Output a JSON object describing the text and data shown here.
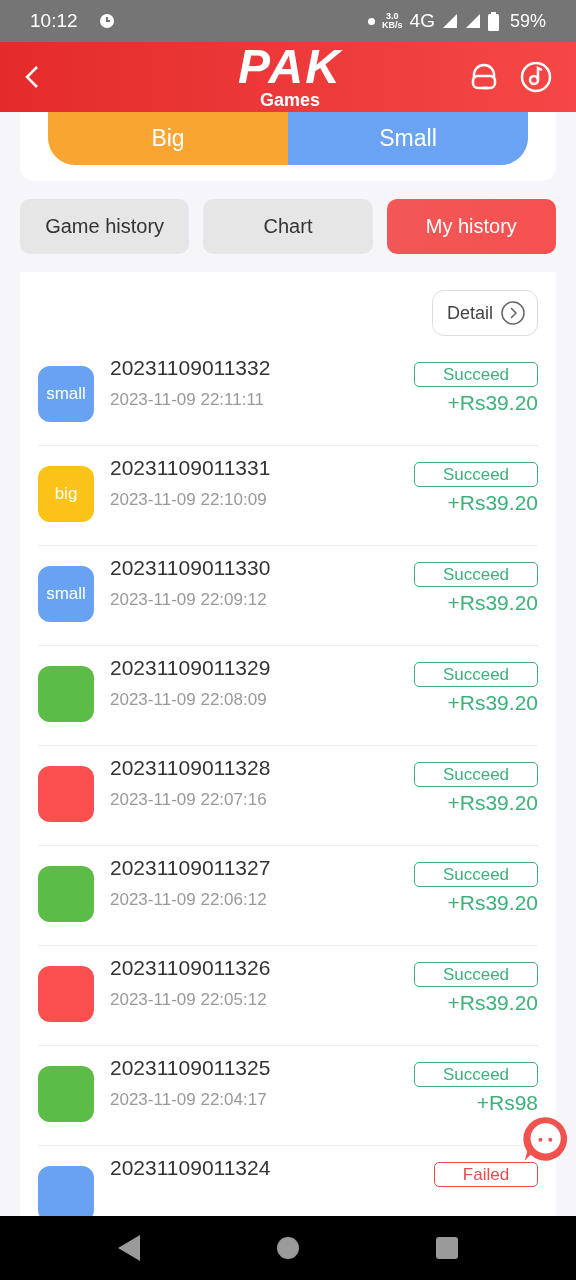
{
  "status_bar": {
    "time": "10:12",
    "speed_value": "3.0",
    "speed_unit": "KB/s",
    "network": "4G",
    "battery": "59%"
  },
  "header": {
    "logo_main": "PAK",
    "logo_sub": "Games"
  },
  "bet_buttons": [
    {
      "label": "Big",
      "kind": "big"
    },
    {
      "label": "Small",
      "kind": "small"
    }
  ],
  "tabs": [
    {
      "label": "Game history",
      "selected": false
    },
    {
      "label": "Chart",
      "selected": false
    },
    {
      "label": "My history",
      "selected": true
    }
  ],
  "detail_button": "Detail",
  "records": [
    {
      "period": "20231109011332",
      "time": "2023-11-09 22:11:11",
      "result": "small",
      "color": "#6aa2f2",
      "status": "Succeed",
      "failed": false,
      "amount": "+Rs39.20"
    },
    {
      "period": "20231109011331",
      "time": "2023-11-09 22:10:09",
      "result": "big",
      "color": "#fbc318",
      "status": "Succeed",
      "failed": false,
      "amount": "+Rs39.20"
    },
    {
      "period": "20231109011330",
      "time": "2023-11-09 22:09:12",
      "result": "small",
      "color": "#6aa2f2",
      "status": "Succeed",
      "failed": false,
      "amount": "+Rs39.20"
    },
    {
      "period": "20231109011329",
      "time": "2023-11-09 22:08:09",
      "color": "#5bbc47",
      "status": "Succeed",
      "failed": false,
      "amount": "+Rs39.20"
    },
    {
      "period": "20231109011328",
      "time": "2023-11-09 22:07:16",
      "color": "#fb4e4e",
      "status": "Succeed",
      "failed": false,
      "amount": "+Rs39.20"
    },
    {
      "period": "20231109011327",
      "time": "2023-11-09 22:06:12",
      "color": "#5bbc47",
      "status": "Succeed",
      "failed": false,
      "amount": "+Rs39.20"
    },
    {
      "period": "20231109011326",
      "time": "2023-11-09 22:05:12",
      "color": "#fb4e4e",
      "status": "Succeed",
      "failed": false,
      "amount": "+Rs39.20"
    },
    {
      "period": "20231109011325",
      "time": "2023-11-09 22:04:17",
      "color": "#5bbc47",
      "status": "Succeed",
      "failed": false,
      "amount": "+Rs98"
    },
    {
      "period": "20231109011324",
      "color": "#6aa2f2",
      "status": "Failed",
      "failed": true
    }
  ]
}
